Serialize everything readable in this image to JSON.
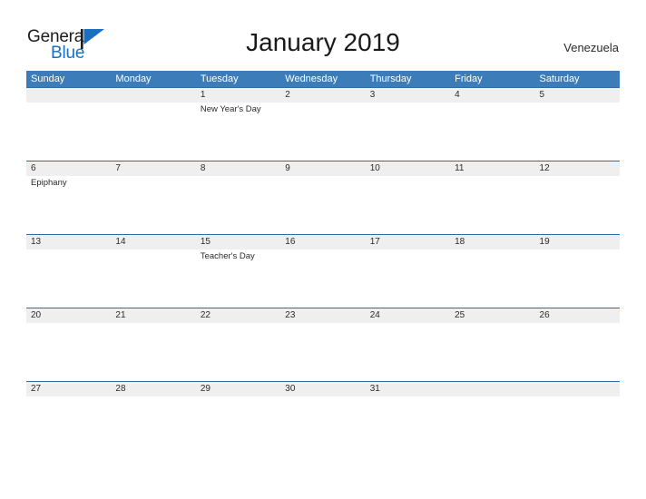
{
  "brand": {
    "name_part1": "General",
    "name_part2": "Blue",
    "logo_icon": "flag-triangle-icon",
    "accent_color": "#1b6fc0"
  },
  "header": {
    "title": "January 2019",
    "region": "Venezuela"
  },
  "theme": {
    "header_blue": "#3c7cb8",
    "row_divider_blue": "#2e6da4",
    "day_band_gray": "#efefef",
    "text_color": "#2b2b2b"
  },
  "calendar": {
    "weekdays": [
      "Sunday",
      "Monday",
      "Tuesday",
      "Wednesday",
      "Thursday",
      "Friday",
      "Saturday"
    ],
    "weeks": [
      [
        {
          "date": "",
          "event": ""
        },
        {
          "date": "",
          "event": ""
        },
        {
          "date": "1",
          "event": "New Year's Day"
        },
        {
          "date": "2",
          "event": ""
        },
        {
          "date": "3",
          "event": ""
        },
        {
          "date": "4",
          "event": ""
        },
        {
          "date": "5",
          "event": ""
        }
      ],
      [
        {
          "date": "6",
          "event": "Epiphany"
        },
        {
          "date": "7",
          "event": ""
        },
        {
          "date": "8",
          "event": ""
        },
        {
          "date": "9",
          "event": ""
        },
        {
          "date": "10",
          "event": ""
        },
        {
          "date": "11",
          "event": ""
        },
        {
          "date": "12",
          "event": ""
        }
      ],
      [
        {
          "date": "13",
          "event": ""
        },
        {
          "date": "14",
          "event": ""
        },
        {
          "date": "15",
          "event": "Teacher's Day"
        },
        {
          "date": "16",
          "event": ""
        },
        {
          "date": "17",
          "event": ""
        },
        {
          "date": "18",
          "event": ""
        },
        {
          "date": "19",
          "event": ""
        }
      ],
      [
        {
          "date": "20",
          "event": ""
        },
        {
          "date": "21",
          "event": ""
        },
        {
          "date": "22",
          "event": ""
        },
        {
          "date": "23",
          "event": ""
        },
        {
          "date": "24",
          "event": ""
        },
        {
          "date": "25",
          "event": ""
        },
        {
          "date": "26",
          "event": ""
        }
      ],
      [
        {
          "date": "27",
          "event": ""
        },
        {
          "date": "28",
          "event": ""
        },
        {
          "date": "29",
          "event": ""
        },
        {
          "date": "30",
          "event": ""
        },
        {
          "date": "31",
          "event": ""
        },
        {
          "date": "",
          "event": ""
        },
        {
          "date": "",
          "event": ""
        }
      ]
    ]
  }
}
